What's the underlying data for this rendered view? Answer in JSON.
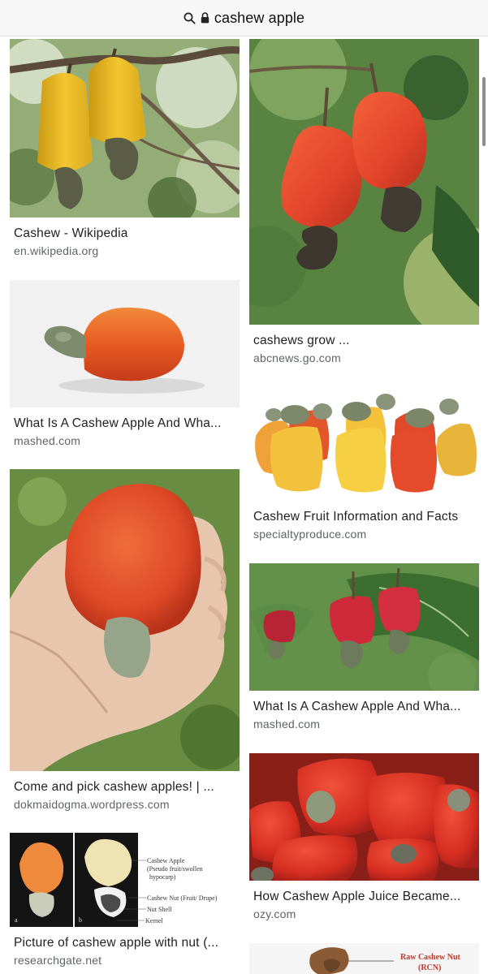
{
  "search": {
    "query": "cashew apple"
  },
  "icons": {
    "search": "search-icon",
    "lock": "lock-icon"
  },
  "results": [
    {
      "title": "Cashew - Wikipedia",
      "source": "en.wikipedia.org"
    },
    {
      "title": "cashews grow ...",
      "source": "abcnews.go.com"
    },
    {
      "title": "What Is A Cashew Apple And Wha...",
      "source": "mashed.com"
    },
    {
      "title": "Cashew Fruit Information and Facts",
      "source": "specialtyproduce.com"
    },
    {
      "title": "Come and pick cashew apples! | ...",
      "source": "dokmaidogma.wordpress.com"
    },
    {
      "title": "What Is A Cashew Apple And Wha...",
      "source": "mashed.com"
    },
    {
      "title": "Picture of cashew apple with nut (...",
      "source": "researchgate.net"
    },
    {
      "title": "How Cashew Apple Juice Became...",
      "source": "ozy.com"
    }
  ],
  "diagram_labels": {
    "panel_a": "a",
    "panel_b": "b",
    "cashew_apple": "Cashew  Apple",
    "pseudo_fruit": "(Pseudo fruit/swollen",
    "hypocarp": "hypocarp)",
    "cashew_nut": "Cashew  Nut (Fruit/ Drupe)",
    "nut_shell": "Nut Shell",
    "kernel": "Kernel"
  },
  "partial_result_label": {
    "line1": "Raw Cashew Nut",
    "line2": "(RCN)"
  }
}
